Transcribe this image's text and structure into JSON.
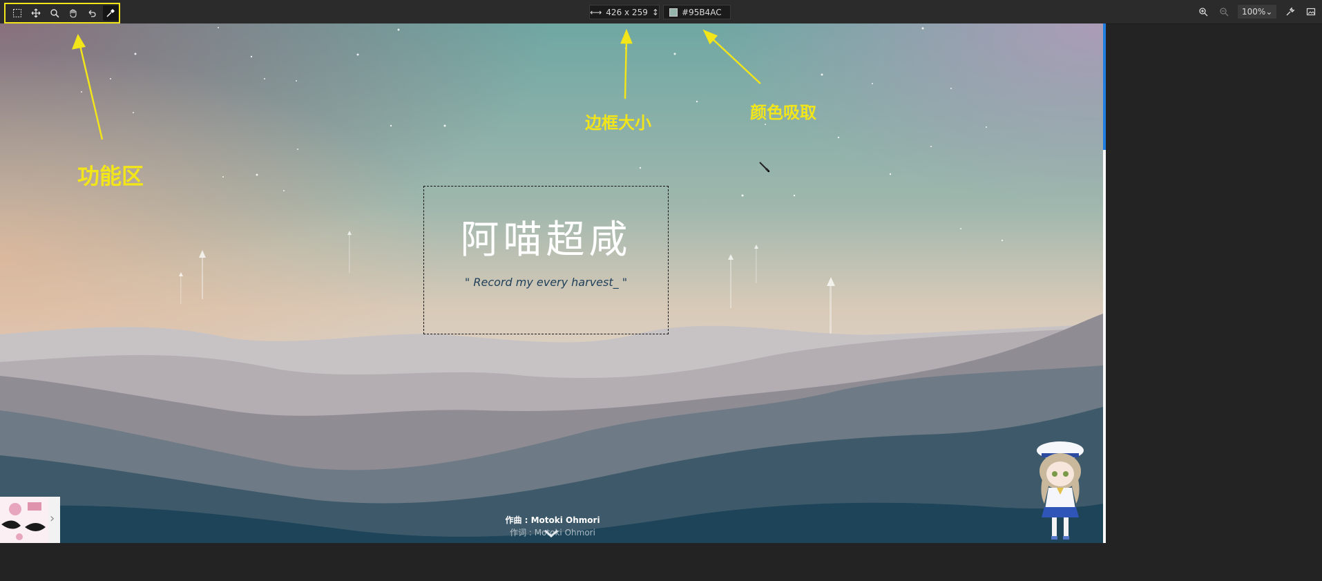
{
  "toolbar": {
    "tools": [
      {
        "name": "marquee-select-icon",
        "label": ""
      },
      {
        "name": "move-icon",
        "label": ""
      },
      {
        "name": "zoom-icon",
        "label": ""
      },
      {
        "name": "hand-icon",
        "label": ""
      },
      {
        "name": "undo-icon",
        "label": ""
      },
      {
        "name": "eyedropper-icon",
        "label": "",
        "active": true
      }
    ],
    "selection_size": "426 x 259",
    "picked_color": "#95B4AC",
    "zoom_level": "100%"
  },
  "page": {
    "title": "阿喵超咸",
    "subtitle": "\" Record my every harvest_ \"",
    "credit_line1": "作曲 : Motoki Ohmori",
    "credit_line2": "作词 : Motoki Ohmori"
  },
  "annotations": {
    "function_area": "功能区",
    "border_size": "边框大小",
    "color_pick": "颜色吸取"
  },
  "colors": {
    "annotation": "#F2E51A",
    "picked": "#95B4AC",
    "scroll_accent": "#1F7FE0"
  }
}
